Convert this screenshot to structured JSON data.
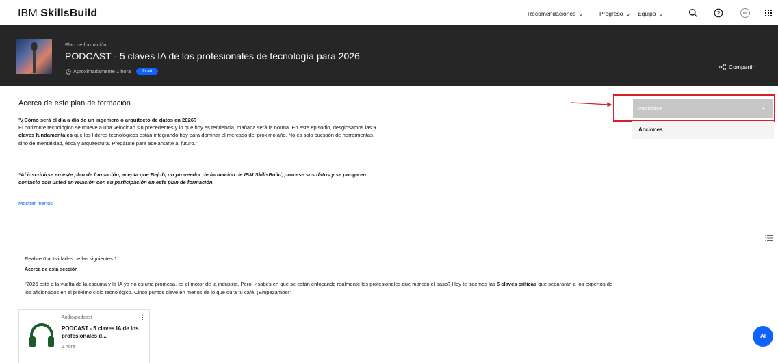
{
  "brand": {
    "part1": "IBM ",
    "part2": "SkillsBuild"
  },
  "nav": {
    "items": [
      {
        "label": "Recomendaciones"
      },
      {
        "label": "Progreso"
      },
      {
        "label": "Equipo"
      }
    ],
    "avatar_initials": "RE",
    "icons": [
      "search-icon",
      "help-icon",
      "avatar",
      "app-switcher-icon"
    ]
  },
  "hero": {
    "kicker": "Plan de formación",
    "title": "PODCAST - 5 claves IA de los profesionales de tecnología para 2026",
    "duration": "Aproximadamente 1 hora",
    "badge": "Draft",
    "share_label": "Compartir"
  },
  "about": {
    "title": "Acerca de este plan de formación",
    "question": "\"¿Cómo será el día a día de un ingeniero o arquitecto de datos en 2026?",
    "para_a": "El horizonte tecnológico se mueve a una velocidad sin precedentes y lo que hoy es tendencia, mañana será la norma. En este episodio, desglosamos las ",
    "para_bold": "5 claves fundamentales",
    "para_b": " que los líderes tecnológicos están integrando hoy para dominar el mercado del próximo año. No es solo cuestión de herramientas, sino de mentalidad, ética y arquitectura. Prepárate para adelantarte al futuro.\"",
    "legal": "*Al inscribirse en este plan de formación, acepta que Bejob, un proveedor de formación de IBM SkillsBuild, procese sus datos y se ponga en contacto con usted en relación con su participación en este plan de formación.",
    "show_less": "Mostrar menos"
  },
  "sidebar": {
    "enroll_label": "Inscribirse",
    "enroll_icon": "+",
    "actions_label": "Acciones"
  },
  "section": {
    "count_text": "Realice 0 actividades de las siguientes 1",
    "heading": "Acerca de esta sección",
    "desc_a": "\"2026 está a la vuelta de la esquina y la IA ya no es una promesa, es el motor de la industria. Pero, ¿sabes en qué se están enfocando realmente los profesionales que marcan el paso? Hoy te traemos las ",
    "desc_bold": "5 claves críticas",
    "desc_b": " que separarán a los expertos de los aficionados en el próximo ciclo tecnológico. Cinco puntos clave en menos de lo que dura tu café. ¡Empezamos!\""
  },
  "card": {
    "kind": "Audio/podcast",
    "title": "PODCAST - 5 claves IA de los profesionales d...",
    "duration": "1 hora",
    "menu": "⋮"
  },
  "ai_button": {
    "label": "AI"
  },
  "colors": {
    "accent": "#0f62fe",
    "hero_bg": "#262626",
    "highlight": "#da1e28",
    "headphones": "#1e5a2c"
  }
}
